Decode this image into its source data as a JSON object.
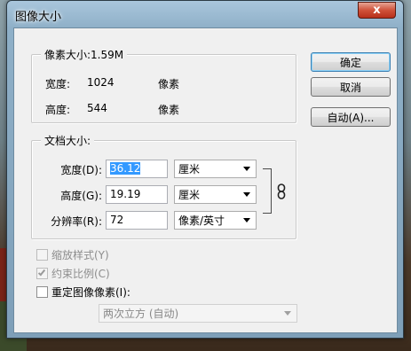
{
  "window": {
    "title": "图像大小",
    "close_label": "x"
  },
  "pixel_dimensions": {
    "legend": "像素大小:1.59M",
    "width_label": "宽度:",
    "width_value": "1024",
    "width_unit": "像素",
    "height_label": "高度:",
    "height_value": "544",
    "height_unit": "像素"
  },
  "document_size": {
    "legend": "文档大小:",
    "width_label": "宽度(D):",
    "width_value": "36.12",
    "width_unit": "厘米",
    "height_label": "高度(G):",
    "height_value": "19.19",
    "height_unit": "厘米",
    "resolution_label": "分辨率(R):",
    "resolution_value": "72",
    "resolution_unit": "像素/英寸"
  },
  "buttons": {
    "ok": "确定",
    "cancel": "取消",
    "auto": "自动(A)..."
  },
  "options": {
    "scale_styles": {
      "label": "缩放样式(Y)",
      "checked": false,
      "enabled": false
    },
    "constrain": {
      "label": "约束比例(C)",
      "checked": true,
      "enabled": false
    },
    "resample": {
      "label": "重定图像像素(I):",
      "checked": false,
      "enabled": true
    },
    "resample_method": "两次立方 (自动)"
  },
  "icons": {
    "close": "close-icon",
    "link": "chain-link-icon",
    "dropdown": "chevron-down-icon"
  },
  "colors": {
    "selection": "#3399ff",
    "title_bar": "#8fb0c8",
    "close_button": "#d0523a"
  }
}
